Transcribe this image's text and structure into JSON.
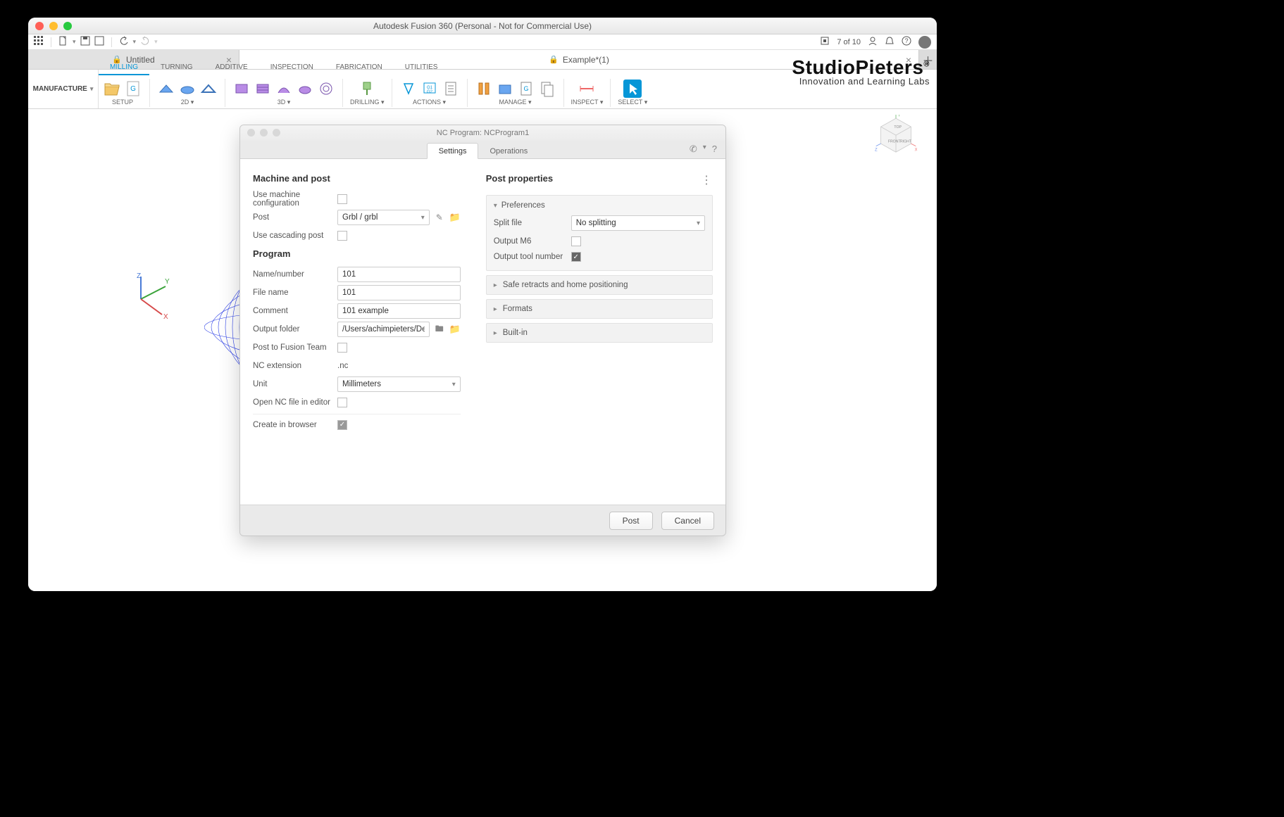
{
  "window": {
    "title": "Autodesk Fusion 360 (Personal - Not for Commercial Use)"
  },
  "quick": {
    "job_count": "7 of 10"
  },
  "tabs": {
    "untitled": "Untitled",
    "example": "Example*(1)"
  },
  "workspace": {
    "label": "MANUFACTURE"
  },
  "ribbon_tabs": {
    "milling": "MILLING",
    "turning": "TURNING",
    "additive": "ADDITIVE",
    "inspection": "INSPECTION",
    "fabrication": "FABRICATION",
    "utilities": "UTILITIES"
  },
  "ribbon_groups": {
    "setup": "SETUP",
    "d2": "2D",
    "d3": "3D",
    "drilling": "DRILLING",
    "actions": "ACTIONS",
    "manage": "MANAGE",
    "inspect": "INSPECT",
    "select": "SELECT"
  },
  "brand": {
    "name": "StudioPieters",
    "tag": "Innovation and Learning Labs"
  },
  "dialog": {
    "title": "NC Program: NCProgram1",
    "tabs": {
      "settings": "Settings",
      "operations": "Operations"
    },
    "left": {
      "h_machine": "Machine and post",
      "use_machine_cfg": "Use machine configuration",
      "post": "Post",
      "post_value": "Grbl / grbl",
      "use_cascading": "Use cascading post",
      "h_program": "Program",
      "name_number": "Name/number",
      "name_number_v": "101",
      "file_name": "File name",
      "file_name_v": "101",
      "comment": "Comment",
      "comment_v": "101 example",
      "output_folder": "Output folder",
      "output_folder_v": "/Users/achimpieters/Desktop",
      "post_team": "Post to Fusion Team",
      "nc_ext": "NC extension",
      "nc_ext_v": ".nc",
      "unit": "Unit",
      "unit_v": "Millimeters",
      "open_editor": "Open NC file in editor",
      "create_browser": "Create in browser"
    },
    "right": {
      "h_post": "Post properties",
      "preferences": "Preferences",
      "split_file": "Split file",
      "split_file_v": "No splitting",
      "output_m6": "Output M6",
      "output_tool_no": "Output tool number",
      "safe_retracts": "Safe retracts and home positioning",
      "formats": "Formats",
      "builtin": "Built-in"
    },
    "footer": {
      "post": "Post",
      "cancel": "Cancel"
    }
  }
}
